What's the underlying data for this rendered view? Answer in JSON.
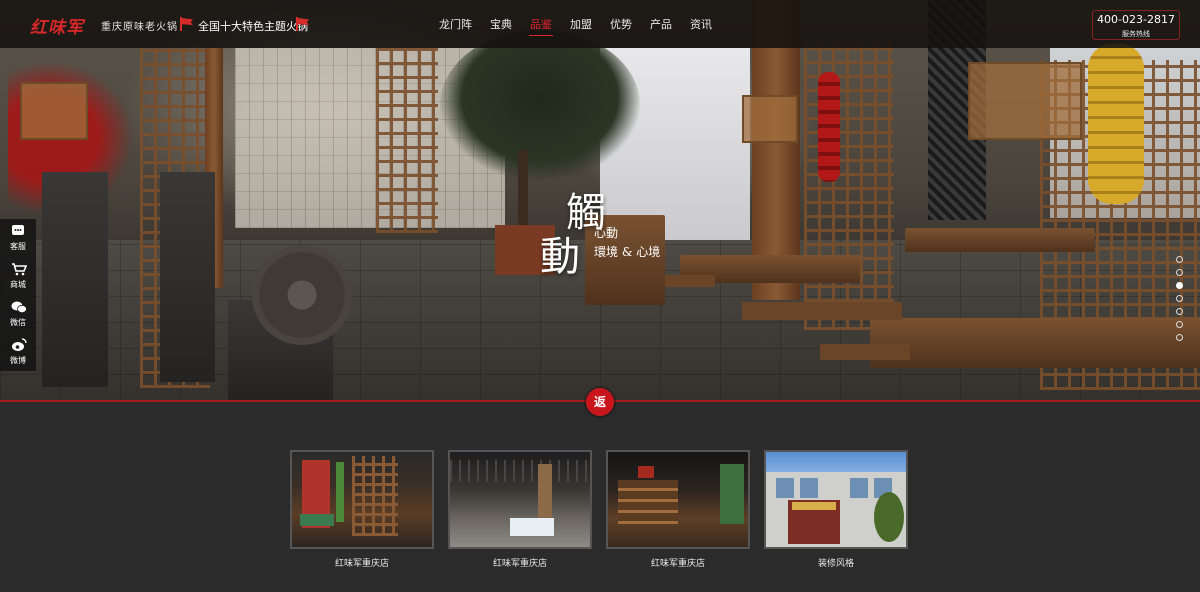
{
  "header": {
    "logo_text": "红味军",
    "logo_sub": "重庆原味老火锅",
    "slogan": "全国十大特色主题火锅",
    "nav": [
      {
        "label": "龙门阵",
        "active": false
      },
      {
        "label": "宝典",
        "active": false
      },
      {
        "label": "品鉴",
        "active": true
      },
      {
        "label": "加盟",
        "active": false
      },
      {
        "label": "优势",
        "active": false
      },
      {
        "label": "产品",
        "active": false
      },
      {
        "label": "资讯",
        "active": false
      }
    ],
    "phone": "400-023-2817",
    "phone_label": "服务热线"
  },
  "hero": {
    "slogan_big_1": "觸",
    "slogan_big_2": "動",
    "slogan_small_1": "心動",
    "slogan_small_2": "環境 & 心境",
    "slide_count": 7,
    "active_slide": 3
  },
  "sidebar": [
    {
      "label": "客服",
      "icon": "chat-icon"
    },
    {
      "label": "商城",
      "icon": "cart-icon"
    },
    {
      "label": "微信",
      "icon": "wechat-icon"
    },
    {
      "label": "微博",
      "icon": "weibo-icon"
    }
  ],
  "back_button": "返",
  "thumbnails": [
    {
      "caption": "红味军重庆店"
    },
    {
      "caption": "红味军重庆店"
    },
    {
      "caption": "红味军重庆店"
    },
    {
      "caption": "装修风格"
    }
  ],
  "colors": {
    "accent": "#e0242a",
    "page_bg": "#2b2b2b",
    "header_bg": "#14100e"
  }
}
